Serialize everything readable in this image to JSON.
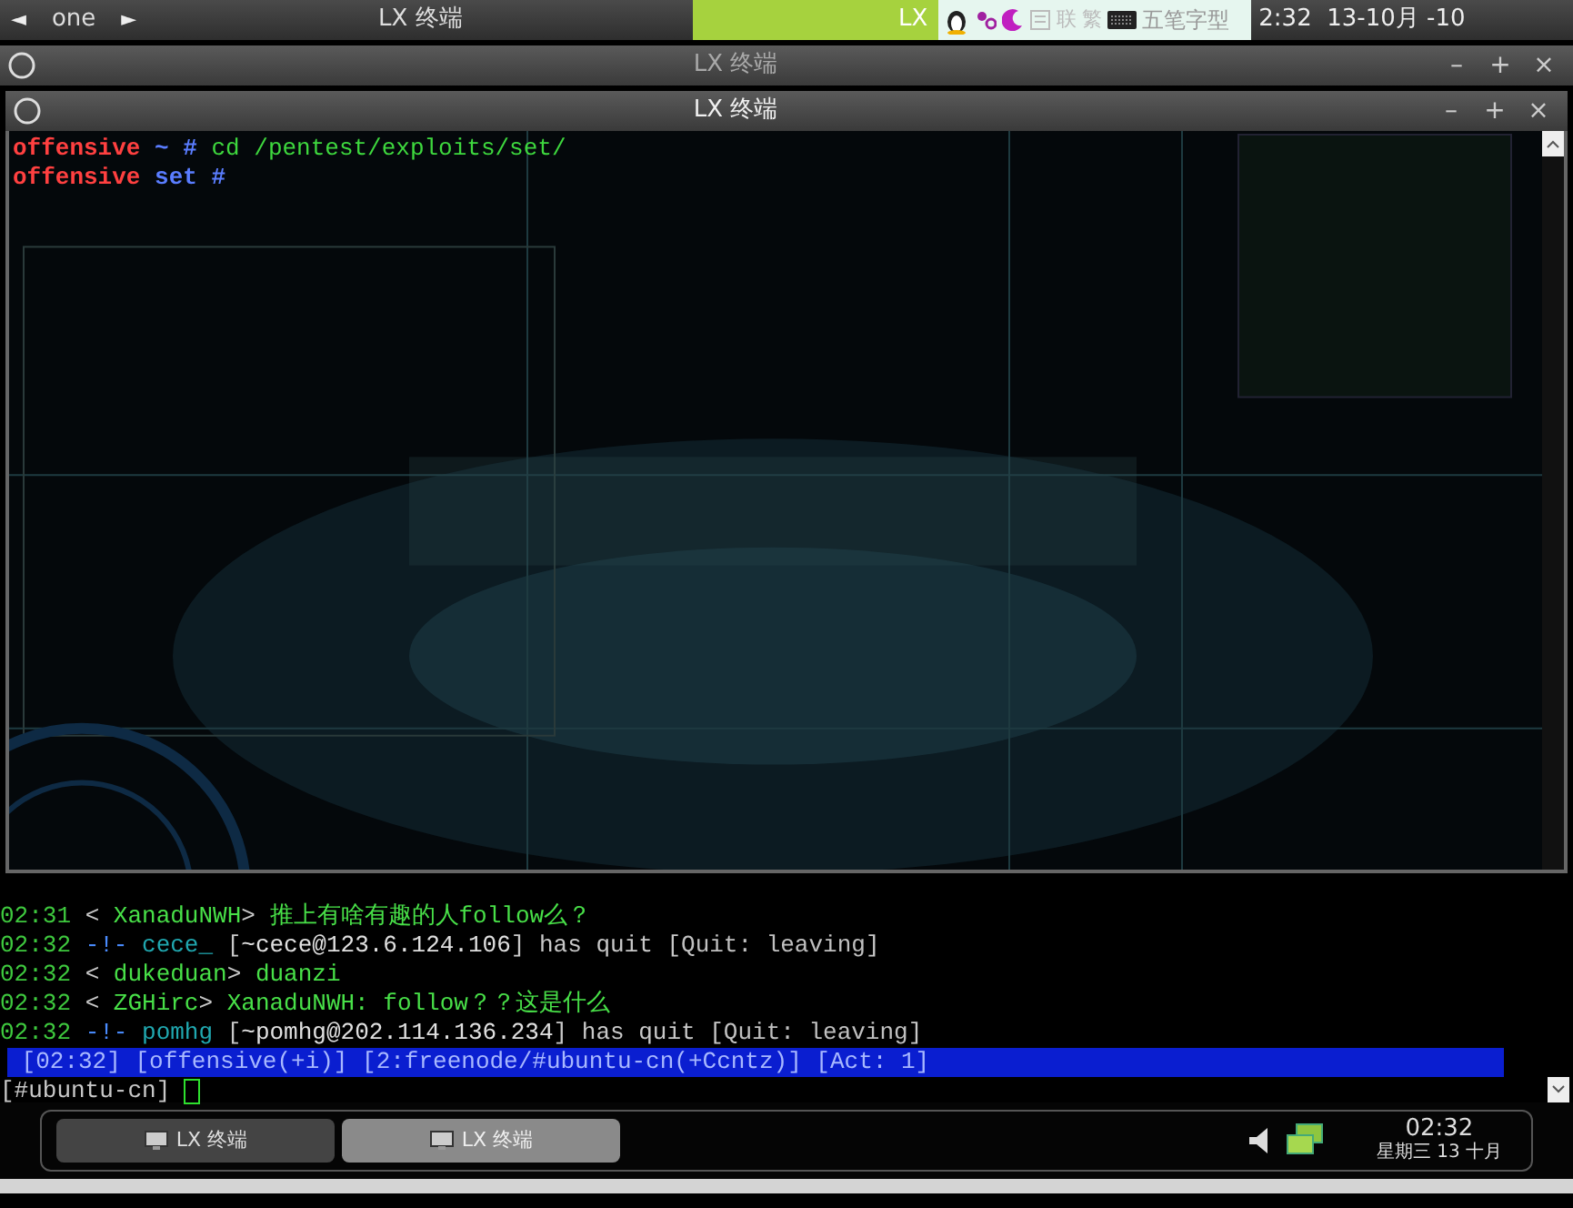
{
  "top_panel": {
    "prev_desktop": "◄",
    "desktop": "one",
    "next_desktop": "►",
    "active_title": "LX 终端",
    "input_method": {
      "label": "LX",
      "toggles": [
        "联",
        "繁"
      ],
      "status": "五笔字型"
    },
    "clock": "2:32  13-10月 -10"
  },
  "windows": [
    {
      "title": "LX 终端",
      "active": false,
      "controls": [
        "–",
        "+",
        "×"
      ]
    },
    {
      "title": "LX 终端",
      "active": true,
      "controls": [
        "–",
        "+",
        "×"
      ]
    }
  ],
  "front_terminal": {
    "lines": [
      [
        {
          "kind": "user",
          "text": "offensive "
        },
        {
          "kind": "path",
          "text": "~ # "
        },
        {
          "kind": "command",
          "text": "cd /pentest/exploits/set/"
        }
      ],
      [
        {
          "kind": "user",
          "text": "offensive "
        },
        {
          "kind": "path",
          "text": "set #"
        }
      ]
    ]
  },
  "back_terminal": {
    "lines": [
      [
        {
          "kind": "time",
          "text": "02:31"
        },
        {
          "kind": "punct",
          "text": " < "
        },
        {
          "kind": "nick",
          "text": "XanaduNWH"
        },
        {
          "kind": "punct",
          "text": "> "
        },
        {
          "kind": "msg",
          "text": "推上有啥有趣的人follow么？"
        }
      ],
      [
        {
          "kind": "time",
          "text": "02:32"
        },
        {
          "kind": "notice",
          "text": " -!- "
        },
        {
          "kind": "quitnick",
          "text": "cece_"
        },
        {
          "kind": "punct",
          "text": " ["
        },
        {
          "kind": "host",
          "text": "~cece@123.6.124.106"
        },
        {
          "kind": "punct",
          "text": "] has quit ["
        },
        {
          "kind": "quitmsg",
          "text": "Quit: leaving"
        },
        {
          "kind": "punct",
          "text": "]"
        }
      ],
      [
        {
          "kind": "time",
          "text": "02:32"
        },
        {
          "kind": "punct",
          "text": " < "
        },
        {
          "kind": "nick",
          "text": "dukeduan"
        },
        {
          "kind": "punct",
          "text": "> "
        },
        {
          "kind": "msg",
          "text": "duanzi"
        }
      ],
      [
        {
          "kind": "time",
          "text": "02:32"
        },
        {
          "kind": "punct",
          "text": " < "
        },
        {
          "kind": "nick",
          "text": "ZGHirc"
        },
        {
          "kind": "punct",
          "text": "> "
        },
        {
          "kind": "msg",
          "text": "XanaduNWH: follow？？这是什么"
        }
      ],
      [
        {
          "kind": "time",
          "text": "02:32"
        },
        {
          "kind": "notice",
          "text": " -!- "
        },
        {
          "kind": "quitnick",
          "text": "pomhg"
        },
        {
          "kind": "punct",
          "text": " ["
        },
        {
          "kind": "host",
          "text": "~pomhg@202.114.136.234"
        },
        {
          "kind": "punct",
          "text": "] has quit ["
        },
        {
          "kind": "quitmsg",
          "text": "Quit: leaving"
        },
        {
          "kind": "punct",
          "text": "]"
        }
      ]
    ],
    "status_bar": " [02:32] [offensive(+i)] [2:freenode/#ubuntu-cn(+Ccntz)] [Act: 1]",
    "prompt": "[#ubuntu-cn] "
  },
  "taskbar": {
    "tasks": [
      {
        "label": "LX 终端",
        "selected": false
      },
      {
        "label": "LX 终端",
        "selected": true
      }
    ],
    "time": "02:32",
    "date": "星期三 13 十月"
  }
}
